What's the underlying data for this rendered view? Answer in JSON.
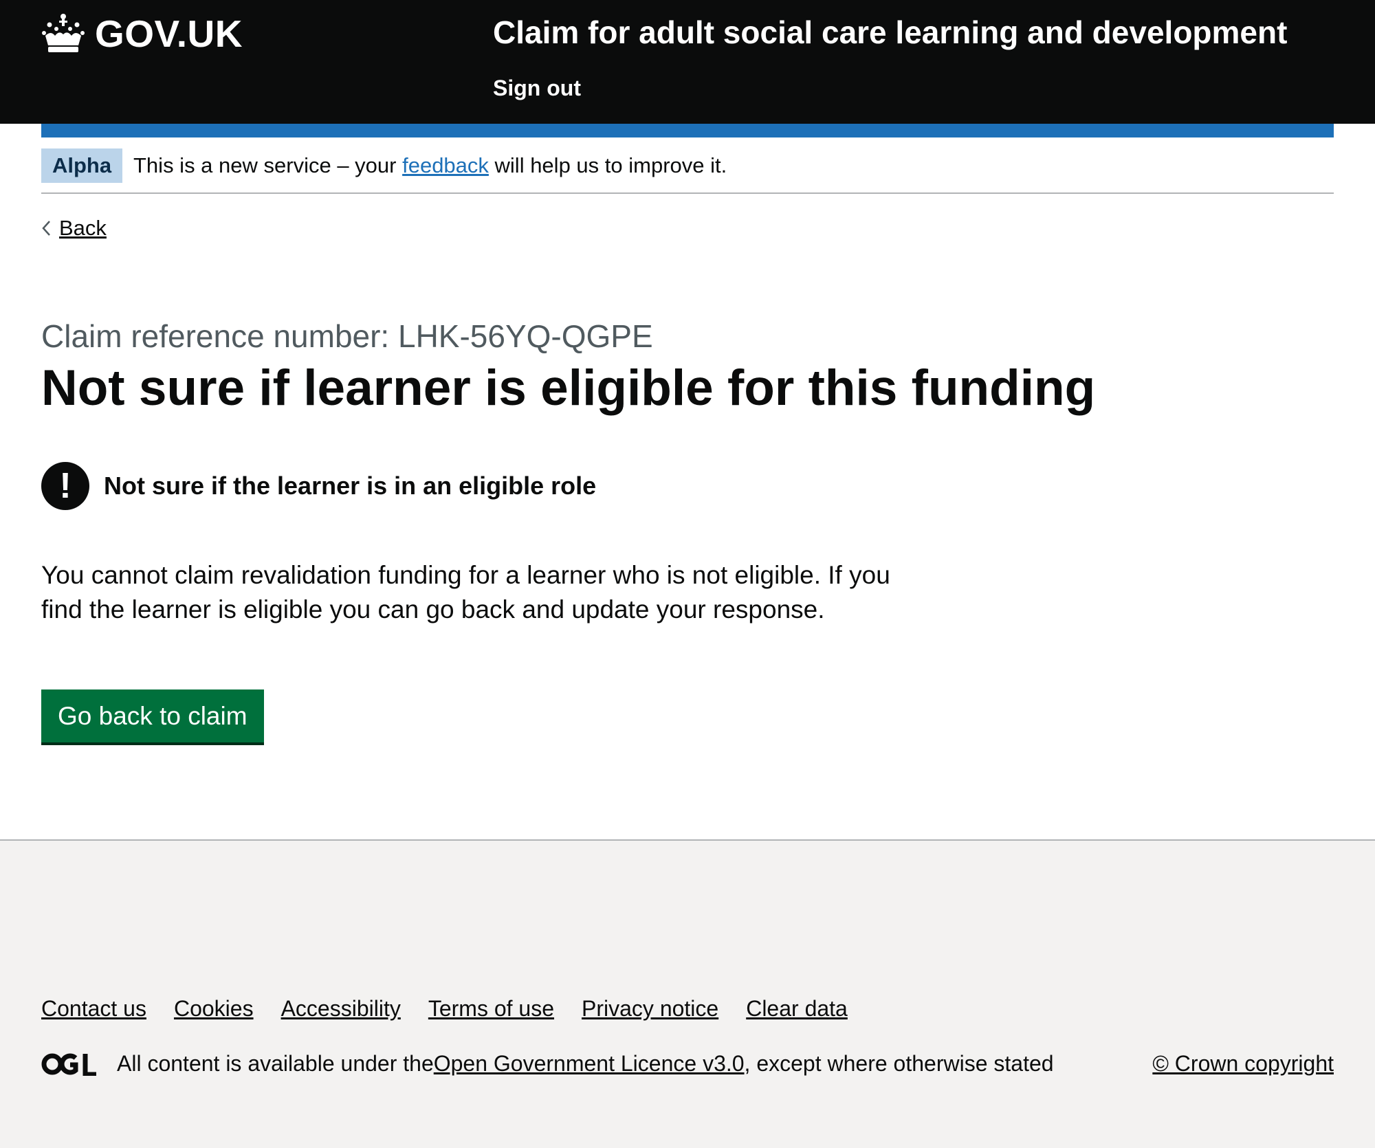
{
  "header": {
    "logo_text": "GOV.UK",
    "service_name": "Claim for adult social care learning and development",
    "sign_out": "Sign out"
  },
  "phase_banner": {
    "tag": "Alpha",
    "text_before": "This is a new service – your ",
    "link": "feedback",
    "text_after": " will help us to improve it."
  },
  "back_link": "Back",
  "main": {
    "caption": "Claim reference number: LHK-56YQ-QGPE",
    "title": "Not sure if learner is eligible for this funding",
    "warning_icon": "!",
    "warning_text": "Not sure if the learner is in an eligible role",
    "body": "You cannot claim revalidation funding for a learner who is not eligible. If you find the learner is eligible you can go back and update your response.",
    "button": "Go back to claim"
  },
  "footer": {
    "links": [
      "Contact us",
      "Cookies",
      "Accessibility",
      "Terms of use",
      "Privacy notice",
      "Clear data"
    ],
    "licence_before": "All content is available under the ",
    "licence_link": "Open Government Licence v3.0",
    "licence_after": ", except where otherwise stated",
    "copyright": "© Crown copyright"
  },
  "colors": {
    "header_bg": "#0b0c0c",
    "brand_blue": "#1d70b8",
    "button_green": "#00703c",
    "footer_bg": "#f3f2f1"
  }
}
